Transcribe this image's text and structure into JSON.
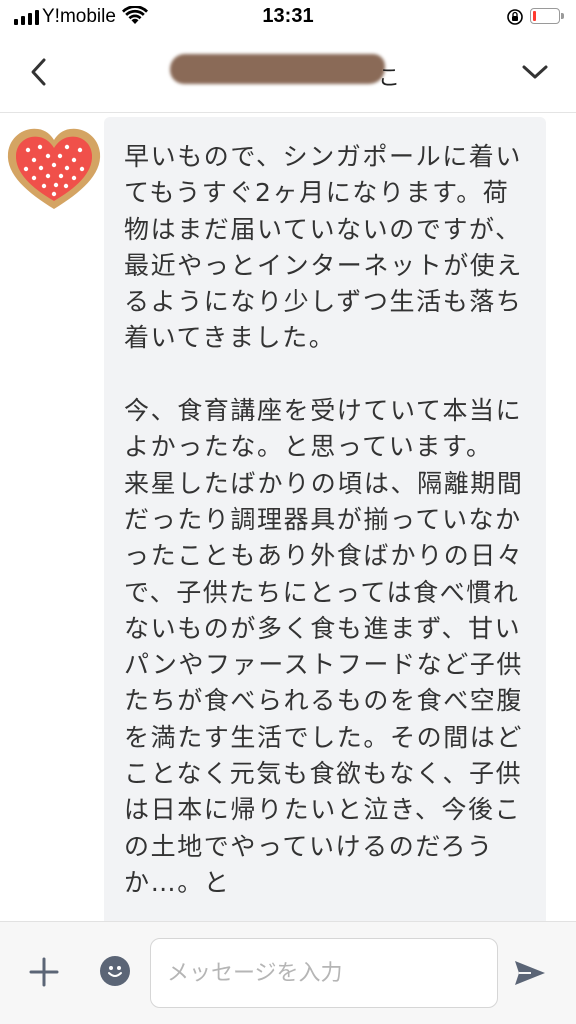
{
  "status_bar": {
    "carrier": "Y!mobile",
    "time": "13:31",
    "battery_level": 0.1,
    "battery_color": "#ff3b30"
  },
  "header": {
    "title_visible_tail": "こ",
    "back_icon": "chevron-left-icon",
    "collapse_icon": "chevron-down-icon"
  },
  "conversation": {
    "messages": [
      {
        "sender_avatar": "red-polka-dot-heart-cookie",
        "text": "早いもので、シンガポールに着いてもうすぐ2ヶ月になります。荷物はまだ届いていないのですが、最近やっとインターネットが使えるようになり少しずつ生活も落ち着いてきました。\n\n今、食育講座を受けていて本当によかったな。と思っています。\n来星したばかりの頃は、隔離期間だったり調理器具が揃っていなかったこともあり外食ばかりの日々で、子供たちにとっては食べ慣れないものが多く食も進まず、甘いパンやファーストフードなど子供たちが食べられるものを食べ空腹を満たす生活でした。その間はどことなく元気も食欲もなく、子供は日本に帰りたいと泣き、今後この土地でやっていけるのだろうか…。と"
      }
    ]
  },
  "input_bar": {
    "placeholder": "メッセージを入力",
    "value": "",
    "plus_icon": "plus-icon",
    "emoji_icon": "smiley-icon",
    "send_icon": "send-icon"
  },
  "colors": {
    "bubble_background": "#f2f3f5",
    "icon_gray": "#5b6576",
    "redaction": "#8a6a57",
    "avatar_heart": "#f0504a",
    "avatar_border": "#d4a463"
  }
}
